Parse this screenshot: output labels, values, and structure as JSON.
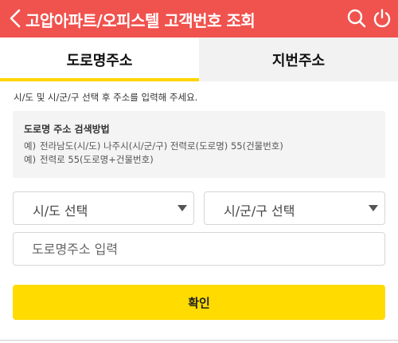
{
  "header": {
    "title": "고압아파트/오피스텔 고객번호 조회",
    "back_icon": "chevron-left-icon",
    "search_icon": "search-icon",
    "power_icon": "power-icon",
    "background_color": "#f0524e"
  },
  "tabs": [
    {
      "label": "도로명주소",
      "active": true
    },
    {
      "label": "지번주소",
      "active": false
    }
  ],
  "accent_color": "#ffd400",
  "instruction": "시/도 및 시/군/구 선택 후 주소를 입력해 주세요.",
  "guide": {
    "title": "도로명 주소 검색방법",
    "examples": [
      {
        "prefix": "예)",
        "text": "전라남도(시/도) 나주시(시/군/구) 전력로(도로명) 55(건물번호)"
      },
      {
        "prefix": "예)",
        "text": "전력로 55(도로명+건물번호)"
      }
    ]
  },
  "selects": {
    "sido": {
      "value": "시/도 선택"
    },
    "sigungu": {
      "value": "시/군/구 선택"
    }
  },
  "road_input": {
    "placeholder": "도로명주소 입력",
    "value": ""
  },
  "confirm_button": {
    "label": "확인",
    "color": "#ffdb00"
  }
}
